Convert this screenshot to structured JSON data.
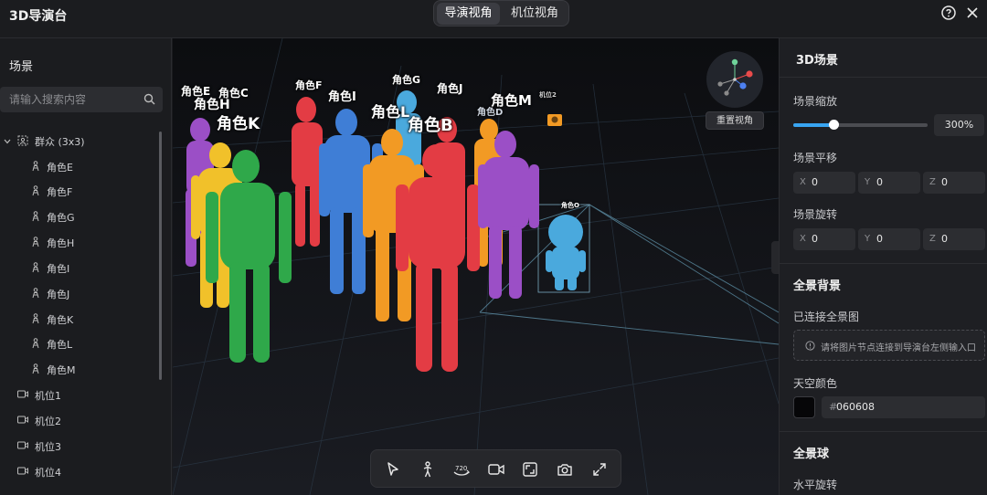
{
  "app": {
    "title": "3D导演台"
  },
  "view_switch": {
    "tabs": [
      "导演视角",
      "机位视角"
    ],
    "active": "导演视角"
  },
  "left_panel": {
    "heading": "场景",
    "search_placeholder": "请输入搜索内容",
    "group": {
      "label": "群众 (3x3)"
    },
    "characters": [
      "角色E",
      "角色F",
      "角色G",
      "角色H",
      "角色I",
      "角色J",
      "角色K",
      "角色L",
      "角色M"
    ],
    "cameras": [
      "机位1",
      "机位2",
      "机位3",
      "机位4"
    ]
  },
  "viewport": {
    "reset_view_label": "重置视角",
    "labels": {
      "e": "角色E",
      "c": "角色C",
      "h": "角色H",
      "k": "角色K",
      "f": "角色F",
      "i": "角色I",
      "g": "角色G",
      "j": "角色J",
      "l": "角色L",
      "b": "角色B",
      "m": "角色M",
      "d": "角色D",
      "o": "角色O",
      "cam2": "机位2"
    },
    "figure_colors": {
      "purple": "#9b4fc6",
      "yellow": "#f1c12a",
      "green": "#2fa84a",
      "red": "#e33c44",
      "blue": "#3f7ed6",
      "orange": "#f29a24",
      "lightblue": "#4aa9dd"
    }
  },
  "right_panel": {
    "title": "3D场景",
    "zoom": {
      "label": "场景缩放",
      "value_text": "300%",
      "level": 0.3
    },
    "translate": {
      "label": "场景平移",
      "x": "0",
      "y": "0",
      "z": "0"
    },
    "rotate": {
      "label": "场景旋转",
      "x": "0",
      "y": "0",
      "z": "0"
    },
    "axis_labels": {
      "x": "X",
      "y": "Y",
      "z": "Z"
    },
    "panorama": {
      "section": "全景背景",
      "connected_label": "已连接全景图",
      "hint": "请将图片节点连接到导演台左侧输入口"
    },
    "sky": {
      "label": "天空颜色",
      "hash": "#",
      "hex": "060608",
      "color": "#060608"
    },
    "sphere": {
      "section": "全景球",
      "h_rotate": "水平旋转"
    }
  }
}
